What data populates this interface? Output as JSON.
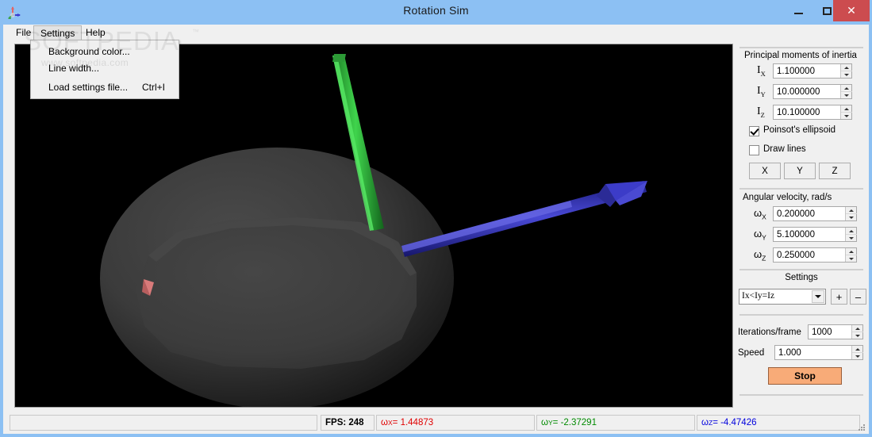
{
  "window": {
    "title": "Rotation Sim",
    "icon": "axes-icon",
    "controls": {
      "minimize": "—",
      "maximize": "□",
      "close": "✕"
    }
  },
  "watermark": {
    "main": "SOFTPEDIA",
    "tm": "™",
    "sub": "www.softpedia.com"
  },
  "menubar": {
    "items": [
      {
        "label": "File"
      },
      {
        "label": "Settings"
      },
      {
        "label": "Help"
      }
    ]
  },
  "settings_menu": {
    "open": true,
    "items": [
      {
        "label": "Background color...",
        "accel": ""
      },
      {
        "label": "Line width...",
        "accel": ""
      },
      {
        "label": "Load settings file...",
        "accel": "Ctrl+I"
      }
    ]
  },
  "viewport": {
    "background_color": "#000000",
    "ellipsoid_color": "#3a3a3a",
    "axes": [
      {
        "name": "x-axis-arrow",
        "color": "#d06a6a",
        "label": "X"
      },
      {
        "name": "y-axis-arrow",
        "color": "#2fa23a",
        "label": "Y"
      },
      {
        "name": "z-axis-arrow",
        "color": "#2a2aa8",
        "label": "Z"
      }
    ]
  },
  "panel": {
    "inertia": {
      "title": "Principal moments of inertia",
      "fields": [
        {
          "label": "I",
          "sub": "X",
          "value": "1.100000"
        },
        {
          "label": "I",
          "sub": "Y",
          "value": "10.000000"
        },
        {
          "label": "I",
          "sub": "Z",
          "value": "10.100000"
        }
      ]
    },
    "checkboxes": [
      {
        "label": "Poinsot's ellipsoid",
        "checked": true
      },
      {
        "label": "Draw lines",
        "checked": false
      }
    ],
    "axis_buttons": [
      {
        "label": "X"
      },
      {
        "label": "Y"
      },
      {
        "label": "Z"
      }
    ],
    "angular_velocity": {
      "title": "Angular velocity, rad/s",
      "fields": [
        {
          "label": "ω",
          "sub": "X",
          "value": "0.200000"
        },
        {
          "label": "ω",
          "sub": "Y",
          "value": "5.100000"
        },
        {
          "label": "ω",
          "sub": "Z",
          "value": "0.250000"
        }
      ]
    },
    "settings": {
      "title": "Settings",
      "preset_selected": "Ix<Iy=Iz",
      "preset_options": [
        "Ix<Iy=Iz"
      ],
      "add_label": "+",
      "remove_label": "–"
    },
    "iterations": {
      "label": "Iterations/frame",
      "value": "1000"
    },
    "speed": {
      "label": "Speed",
      "value": "1.000"
    },
    "run_button": {
      "label": "Stop",
      "color": "#f8ab78"
    }
  },
  "statusbar": {
    "empty": "",
    "fps": "FPS: 248",
    "omega_x": {
      "label": "ω",
      "sub": "X",
      "text": " = 1.44873",
      "color": "#e00000"
    },
    "omega_y": {
      "label": "ω",
      "sub": "Y",
      "text": " = -2.37291",
      "color": "#008a00"
    },
    "omega_z": {
      "label": "ω",
      "sub": "Z",
      "text": " = -4.47426",
      "color": "#0000dd"
    }
  }
}
